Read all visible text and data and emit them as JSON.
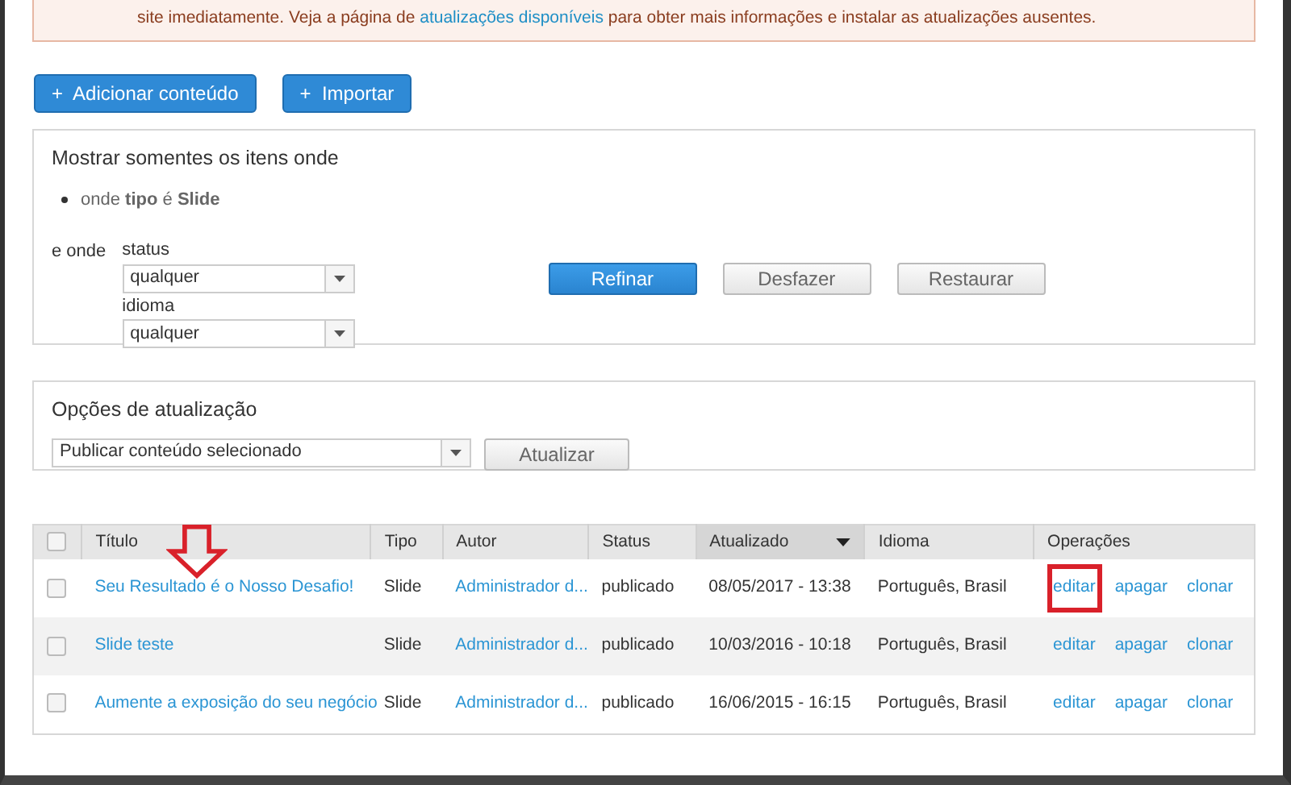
{
  "alert": {
    "text_before": "site imediatamente. Veja a página de ",
    "link": "atualizações disponíveis",
    "text_after": " para obter mais informações e instalar as atualizações ausentes."
  },
  "actions": [
    {
      "icon": "+",
      "label": "Adicionar conteúdo"
    },
    {
      "icon": "+",
      "label": "Importar"
    }
  ],
  "filter": {
    "title": "Mostrar somentes os itens onde",
    "condition": "onde **tipo** é **Slide**",
    "and_label": "e onde",
    "fields": [
      {
        "label": "status",
        "value": "qualquer"
      },
      {
        "label": "idioma",
        "value": "qualquer"
      }
    ],
    "buttons": [
      {
        "label": "Refinar",
        "primary": true
      },
      {
        "label": "Desfazer",
        "primary": false
      },
      {
        "label": "Restaurar",
        "primary": false
      }
    ]
  },
  "update_options": {
    "title": "Opções de atualização",
    "value": "Publicar conteúdo selecionado",
    "button": "Atualizar"
  },
  "table": {
    "select_all_checked": false,
    "columns": [
      {
        "label": "Título",
        "sorted": false
      },
      {
        "label": "Tipo",
        "sorted": false
      },
      {
        "label": "Autor",
        "sorted": false
      },
      {
        "label": "Status",
        "sorted": false
      },
      {
        "label": "Atualizado",
        "sorted": true
      },
      {
        "label": "Idioma",
        "sorted": false
      },
      {
        "label": "Operações",
        "sorted": false
      }
    ],
    "rows": [
      {
        "checked": false,
        "arrow": true,
        "title": "Seu Resultado é o Nosso Desafio!",
        "type": "Slide",
        "author": "Administrador d...",
        "status": "publicado",
        "updated": "08/05/2017 - 13:38",
        "language": "Português, Brasil",
        "operations": [
          {
            "label": "editar",
            "highlighted": true
          },
          {
            "label": "apagar",
            "highlighted": false
          },
          {
            "label": "clonar",
            "highlighted": false
          }
        ]
      },
      {
        "checked": false,
        "arrow": false,
        "title": "Slide teste",
        "type": "Slide",
        "author": "Administrador d...",
        "status": "publicado",
        "updated": "10/03/2016 - 10:18",
        "language": "Português, Brasil",
        "operations": [
          {
            "label": "editar",
            "highlighted": false
          },
          {
            "label": "apagar",
            "highlighted": false
          },
          {
            "label": "clonar",
            "highlighted": false
          }
        ]
      },
      {
        "checked": false,
        "arrow": false,
        "title": "Aumente a exposição do seu negócio",
        "type": "Slide",
        "author": "Administrador d...",
        "status": "publicado",
        "updated": "16/06/2015 - 16:15",
        "language": "Português, Brasil",
        "operations": [
          {
            "label": "editar",
            "highlighted": false
          },
          {
            "label": "apagar",
            "highlighted": false
          },
          {
            "label": "clonar",
            "highlighted": false
          }
        ]
      }
    ]
  }
}
